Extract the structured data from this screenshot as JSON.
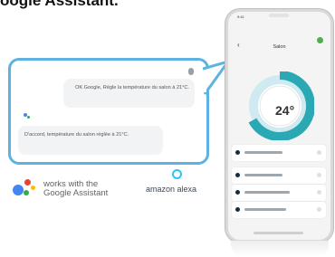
{
  "headline": "oogle Assistant.",
  "dialog": {
    "user_message": "OK Google, Règle la température du salon à 21°C.",
    "assistant_message": "D'accord, température du salon réglée à 21°C."
  },
  "badges": {
    "google_line1": "works with the",
    "google_line2": "Google Assistant",
    "alexa": "amazon alexa"
  },
  "phone": {
    "time": "9:41",
    "room_title": "Salon",
    "temperature": "24°"
  },
  "colors": {
    "bubble_border": "#5cb3e3",
    "dial_teal": "#2aa9b5",
    "alexa_blue": "#31c4f3"
  }
}
